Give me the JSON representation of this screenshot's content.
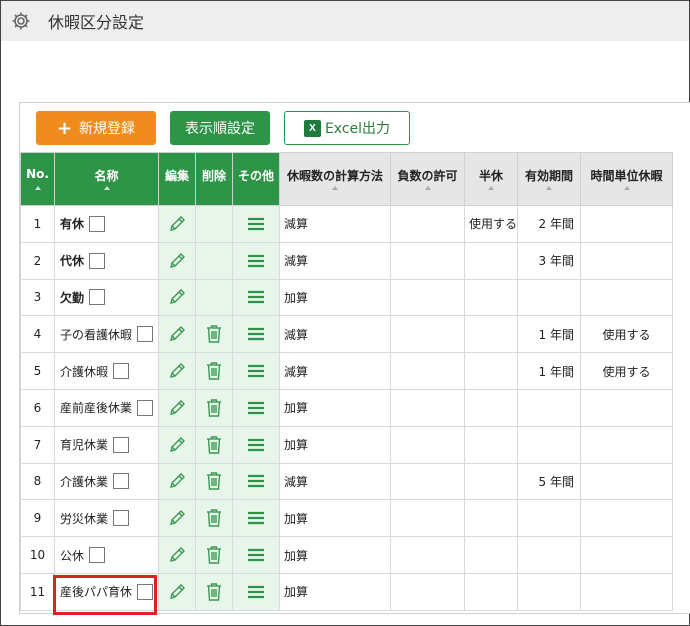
{
  "header": {
    "title": "休暇区分設定",
    "icon": "gear-icon"
  },
  "toolbar": {
    "new_label": "新規登録",
    "new_icon": "plus-icon",
    "order_label": "表示順設定",
    "excel_label": "Excel出力",
    "excel_icon": "excel-icon"
  },
  "columns": {
    "no": "No.",
    "name": "名称",
    "edit": "編集",
    "delete": "削除",
    "other": "その他",
    "calc": "休暇数の計算方法",
    "negative": "負数の許可",
    "half": "半休",
    "validity": "有効期間",
    "hourly": "時間単位休暇"
  },
  "rows": [
    {
      "no": "1",
      "name": "有休",
      "bold": true,
      "deletable": false,
      "calc": "減算",
      "negative": "",
      "half": "使用する",
      "validity": "2 年間",
      "hourly": ""
    },
    {
      "no": "2",
      "name": "代休",
      "bold": true,
      "deletable": false,
      "calc": "減算",
      "negative": "",
      "half": "",
      "validity": "3 年間",
      "hourly": ""
    },
    {
      "no": "3",
      "name": "欠勤",
      "bold": true,
      "deletable": false,
      "calc": "加算",
      "negative": "",
      "half": "",
      "validity": "",
      "hourly": ""
    },
    {
      "no": "4",
      "name": "子の看護休暇",
      "bold": false,
      "deletable": true,
      "calc": "減算",
      "negative": "",
      "half": "",
      "validity": "1 年間",
      "hourly": "使用する"
    },
    {
      "no": "5",
      "name": "介護休暇",
      "bold": false,
      "deletable": true,
      "calc": "減算",
      "negative": "",
      "half": "",
      "validity": "1 年間",
      "hourly": "使用する"
    },
    {
      "no": "6",
      "name": "産前産後休業",
      "bold": false,
      "deletable": true,
      "calc": "加算",
      "negative": "",
      "half": "",
      "validity": "",
      "hourly": ""
    },
    {
      "no": "7",
      "name": "育児休業",
      "bold": false,
      "deletable": true,
      "calc": "加算",
      "negative": "",
      "half": "",
      "validity": "",
      "hourly": ""
    },
    {
      "no": "8",
      "name": "介護休業",
      "bold": false,
      "deletable": true,
      "calc": "減算",
      "negative": "",
      "half": "",
      "validity": "5 年間",
      "hourly": ""
    },
    {
      "no": "9",
      "name": "労災休業",
      "bold": false,
      "deletable": true,
      "calc": "加算",
      "negative": "",
      "half": "",
      "validity": "",
      "hourly": ""
    },
    {
      "no": "10",
      "name": "公休",
      "bold": false,
      "deletable": true,
      "calc": "加算",
      "negative": "",
      "half": "",
      "validity": "",
      "hourly": ""
    },
    {
      "no": "11",
      "name": "産後パパ育休",
      "bold": false,
      "deletable": true,
      "calc": "加算",
      "negative": "",
      "half": "",
      "validity": "",
      "hourly": ""
    }
  ],
  "colors": {
    "green": "#2e9448",
    "orange": "#f08c1e",
    "highlight": "#e0201c"
  }
}
